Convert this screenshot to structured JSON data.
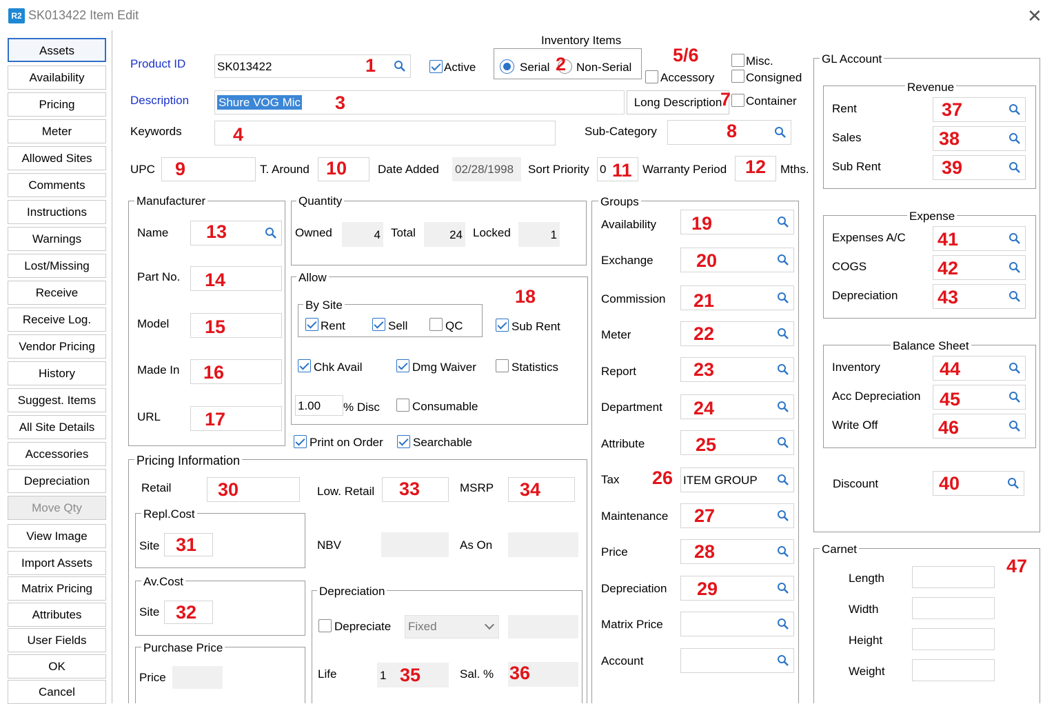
{
  "window": {
    "logo": "R2",
    "title": "SK013422 Item Edit",
    "close": "✕"
  },
  "nav": [
    "Assets",
    "Availability",
    "Pricing",
    "Meter",
    "Allowed Sites",
    "Comments",
    "Instructions",
    "Warnings",
    "Lost/Missing",
    "Receive",
    "Receive Log.",
    "Vendor Pricing",
    "History",
    "Suggest. Items",
    "All Site Details",
    "Accessories",
    "Depreciation",
    "Move Qty",
    "View Image",
    "Import Assets",
    "Matrix Pricing",
    "Attributes",
    "User Fields",
    "OK",
    "Cancel"
  ],
  "header": {
    "product_id_label": "Product ID",
    "product_id_value": "SK013422",
    "active_label": "Active",
    "inventory_items_label": "Inventory Items",
    "serial_label": "Serial",
    "non_serial_label": "Non-Serial",
    "accessory_label": "Accessory",
    "misc_label": "Misc.",
    "consigned_label": "Consigned",
    "container_label": "Container",
    "description_label": "Description",
    "description_value": "Shure VOG Mic",
    "long_description_button": "Long Description",
    "keywords_label": "Keywords",
    "sub_category_label": "Sub-Category",
    "upc_label": "UPC",
    "t_around_label": "T. Around",
    "date_added_label": "Date Added",
    "date_added_value": "02/28/1998",
    "sort_priority_label": "Sort Priority",
    "sort_priority_value": "0",
    "warranty_label": "Warranty Period",
    "mths_label": "Mths."
  },
  "manufacturer": {
    "title": "Manufacturer",
    "name": "Name",
    "part_no": "Part No.",
    "model": "Model",
    "made_in": "Made In",
    "url": "URL"
  },
  "quantity": {
    "title": "Quantity",
    "owned_label": "Owned",
    "owned": "4",
    "total_label": "Total",
    "total": "24",
    "locked_label": "Locked",
    "locked": "1"
  },
  "allow": {
    "title": "Allow",
    "by_site": "By Site",
    "rent": "Rent",
    "sell": "Sell",
    "qc": "QC",
    "sub_rent": "Sub Rent",
    "chk_avail": "Chk Avail",
    "dmg_waiver": "Dmg Waiver",
    "statistics": "Statistics",
    "disc_value": "1.00",
    "disc_label": "% Disc",
    "consumable": "Consumable"
  },
  "print_on_order": "Print on Order",
  "searchable": "Searchable",
  "pricing": {
    "title": "Pricing Information",
    "retail": "Retail",
    "low_retail": "Low. Retail",
    "msrp": "MSRP",
    "repl_cost": "Repl.Cost",
    "site": "Site",
    "nbv": "NBV",
    "as_on": "As On",
    "av_cost": "Av.Cost",
    "purchase_price": "Purchase Price",
    "price": "Price"
  },
  "depreciation": {
    "title": "Depreciation",
    "depreciate": "Depreciate",
    "method": "Fixed",
    "life": "Life",
    "life_value": "1",
    "sal": "Sal. %"
  },
  "groups": {
    "title": "Groups",
    "items": [
      "Availability",
      "Exchange",
      "Commission",
      "Meter",
      "Report",
      "Department",
      "Attribute",
      "Tax",
      "Maintenance",
      "Price",
      "Depreciation",
      "Matrix Price",
      "Account"
    ],
    "tax_value": "ITEM GROUP"
  },
  "gl": {
    "title": "GL Account",
    "revenue": "Revenue",
    "rent": "Rent",
    "sales": "Sales",
    "sub_rent": "Sub Rent",
    "expense": "Expense",
    "expenses_ac": "Expenses A/C",
    "cogs": "COGS",
    "depreciation": "Depreciation",
    "balance_sheet": "Balance Sheet",
    "inventory": "Inventory",
    "acc_depreciation": "Acc Depreciation",
    "write_off": "Write Off",
    "discount": "Discount"
  },
  "carnet": {
    "title": "Carnet",
    "length": "Length",
    "width": "Width",
    "height": "Height",
    "weight": "Weight"
  },
  "markers": {
    "m1": "1",
    "m2": "2",
    "m3": "3",
    "m4": "4",
    "m56": "5/6",
    "m7": "7",
    "m8": "8",
    "m9": "9",
    "m10": "10",
    "m11": "11",
    "m12": "12",
    "m13": "13",
    "m14": "14",
    "m15": "15",
    "m16": "16",
    "m17": "17",
    "m18": "18",
    "m19": "19",
    "m20": "20",
    "m21": "21",
    "m22": "22",
    "m23": "23",
    "m24": "24",
    "m25": "25",
    "m26": "26",
    "m27": "27",
    "m28": "28",
    "m29": "29",
    "m30": "30",
    "m31": "31",
    "m32": "32",
    "m33": "33",
    "m34": "34",
    "m35": "35",
    "m36": "36",
    "m37": "37",
    "m38": "38",
    "m39": "39",
    "m40": "40",
    "m41": "41",
    "m42": "42",
    "m43": "43",
    "m44": "44",
    "m45": "45",
    "m46": "46",
    "m47": "47"
  },
  "colors": {
    "accent": "#2b74c7",
    "link_label": "#1a33c9",
    "marker": "#e2141a",
    "selection": "#3c86d6"
  },
  "icons": {
    "lookup": "magnifier-icon",
    "close": "close-icon",
    "logo": "r2-logo-icon"
  }
}
